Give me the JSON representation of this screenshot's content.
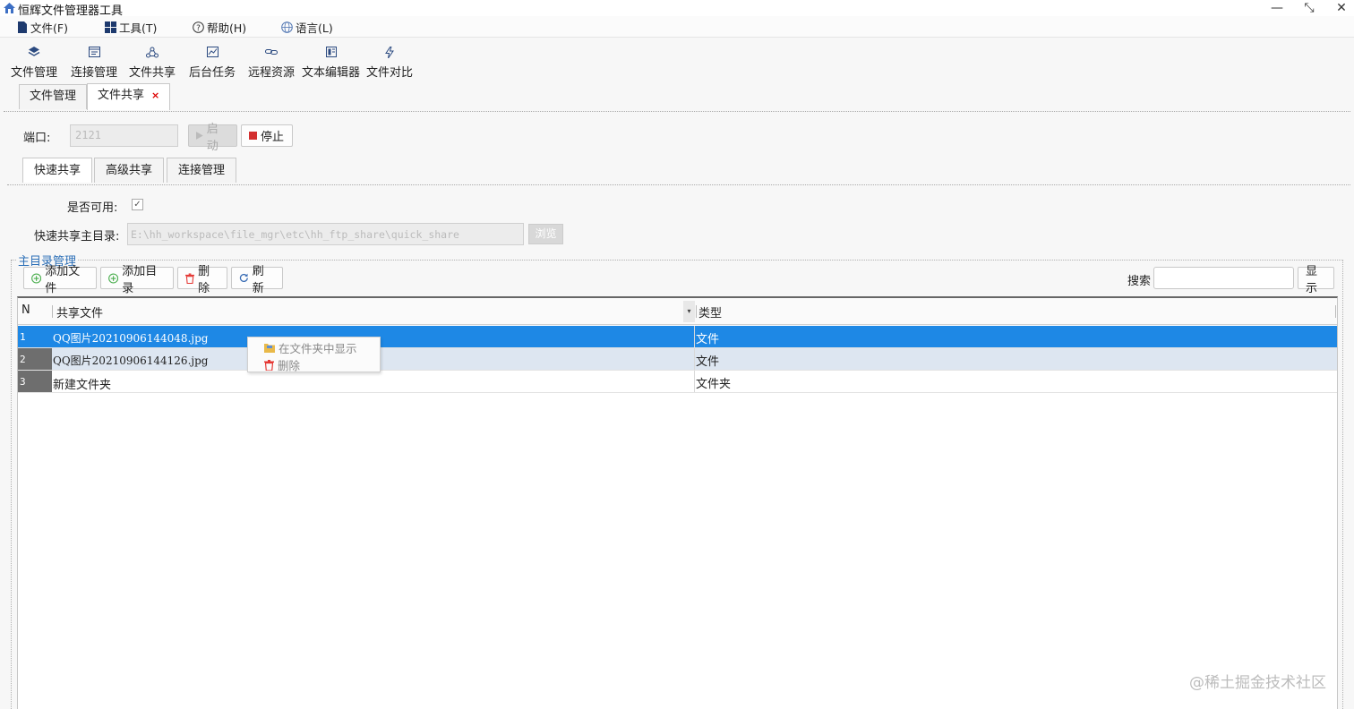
{
  "window": {
    "title": "恒辉文件管理器工具",
    "minimize_glyph": "—",
    "restore_glyph": "⤡",
    "close_glyph": "✕"
  },
  "menu": [
    {
      "label": "文件(F)",
      "icon": "file-icon"
    },
    {
      "label": "工具(T)",
      "icon": "grid-icon"
    },
    {
      "label": "帮助(H)",
      "icon": "help-icon"
    },
    {
      "label": "语言(L)",
      "icon": "globe-icon"
    }
  ],
  "toolbar": [
    {
      "label": "文件管理",
      "icon": "layers-icon"
    },
    {
      "label": "连接管理",
      "icon": "connect-icon"
    },
    {
      "label": "文件共享",
      "icon": "share-icon"
    },
    {
      "label": "后台任务",
      "icon": "chart-icon"
    },
    {
      "label": "远程资源",
      "icon": "link-icon"
    },
    {
      "label": "文本编辑器",
      "icon": "editor-icon"
    },
    {
      "label": "文件对比",
      "icon": "bolt-icon"
    }
  ],
  "tabs": [
    {
      "label": "文件管理",
      "active": false
    },
    {
      "label": "文件共享",
      "active": true,
      "close": "×"
    }
  ],
  "server": {
    "port_label": "端口:",
    "port_value": "2121",
    "start_label": "启动",
    "stop_label": "停止"
  },
  "subtabs": [
    {
      "label": "快速共享",
      "active": true
    },
    {
      "label": "高级共享",
      "active": false
    },
    {
      "label": "连接管理",
      "active": false
    }
  ],
  "quick_share": {
    "enabled_label": "是否可用:",
    "enabled": true,
    "check_glyph": "✓",
    "dir_label": "快速共享主目录:",
    "dir_value": "E:\\hh_workspace\\file_mgr\\etc\\hh_ftp_share\\quick_share",
    "browse_label": "浏览"
  },
  "group": {
    "title": "主目录管理",
    "add_file_label": "添加文件",
    "add_dir_label": "添加目录",
    "delete_label": "删除",
    "refresh_label": "刷新",
    "search_label": "搜索",
    "search_value": "",
    "show_label": "显示"
  },
  "table": {
    "columns": [
      "N",
      "共享文件",
      "类型"
    ],
    "sort_glyph": "▾",
    "rows": [
      {
        "n": "1",
        "file": "QQ图片20210906144048.jpg",
        "type": "文件",
        "state": "selected"
      },
      {
        "n": "2",
        "file": "QQ图片20210906144126.jpg",
        "type": "文件",
        "state": "alt"
      },
      {
        "n": "3",
        "file": "新建文件夹",
        "type": "文件夹",
        "state": "normal"
      }
    ]
  },
  "context_menu": [
    {
      "label": "在文件夹中显示",
      "icon": "folder-icon"
    },
    {
      "label": "删除",
      "icon": "trash-icon"
    }
  ],
  "watermark": "@稀土掘金技术社区",
  "colors": {
    "selection": "#1e88e5",
    "alt_row": "#dde6f1",
    "group_title": "#2c6fb7",
    "stop_red": "#d32f2f",
    "add_green": "#4caf50",
    "delete_red": "#e53935"
  }
}
